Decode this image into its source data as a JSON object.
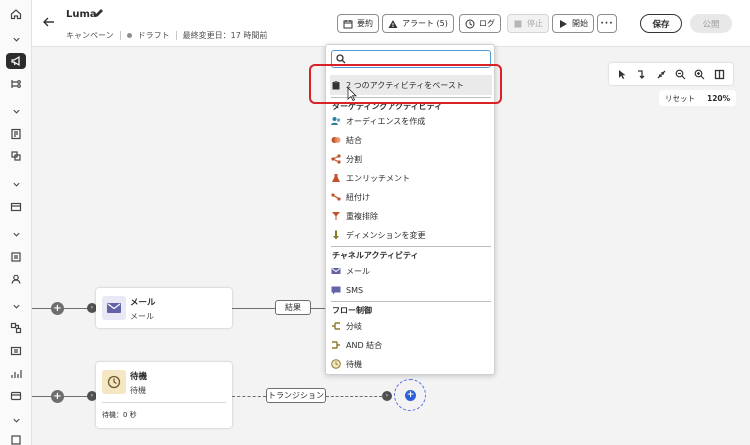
{
  "header": {
    "title": "Luma",
    "meta_type": "キャンペーン",
    "meta_status": "ドラフト",
    "meta_modified": "最終変更日：17 時間前",
    "buttons": {
      "summary": "要約",
      "alerts": "アラート (5)",
      "log": "ログ",
      "stop": "停止",
      "start": "開始",
      "save": "保存",
      "publish": "公開"
    }
  },
  "canvas": {
    "reset_label": "リセット",
    "zoom_level": "120%",
    "nodes": {
      "email": {
        "title": "メール",
        "subtitle": "メール",
        "outgoing": "結果"
      },
      "wait": {
        "title": "待機",
        "subtitle": "待機",
        "footer": "待機：0 秒",
        "outgoing": "トランジション"
      }
    }
  },
  "popover": {
    "search_placeholder": "",
    "paste_label": "2 つのアクティビティをペースト",
    "targeting_header": "ターゲティングアクティビティ",
    "targeting_items": [
      "オーディエンスを作成",
      "結合",
      "分割",
      "エンリッチメント",
      "紐付け",
      "重複排除",
      "ディメンションを変更"
    ],
    "channel_header": "チャネルアクティビティ",
    "channel_items": [
      "メール",
      "SMS"
    ],
    "flow_header": "フロー制御",
    "flow_items": [
      "分岐",
      "AND 結合",
      "待機"
    ]
  },
  "colors": {
    "highlight": "#d92128",
    "search_border": "#4f9bd6",
    "email_icon": "#6264a7",
    "wait_icon_bg": "#f5e6c4",
    "add_blue": "#2c5fd8"
  }
}
